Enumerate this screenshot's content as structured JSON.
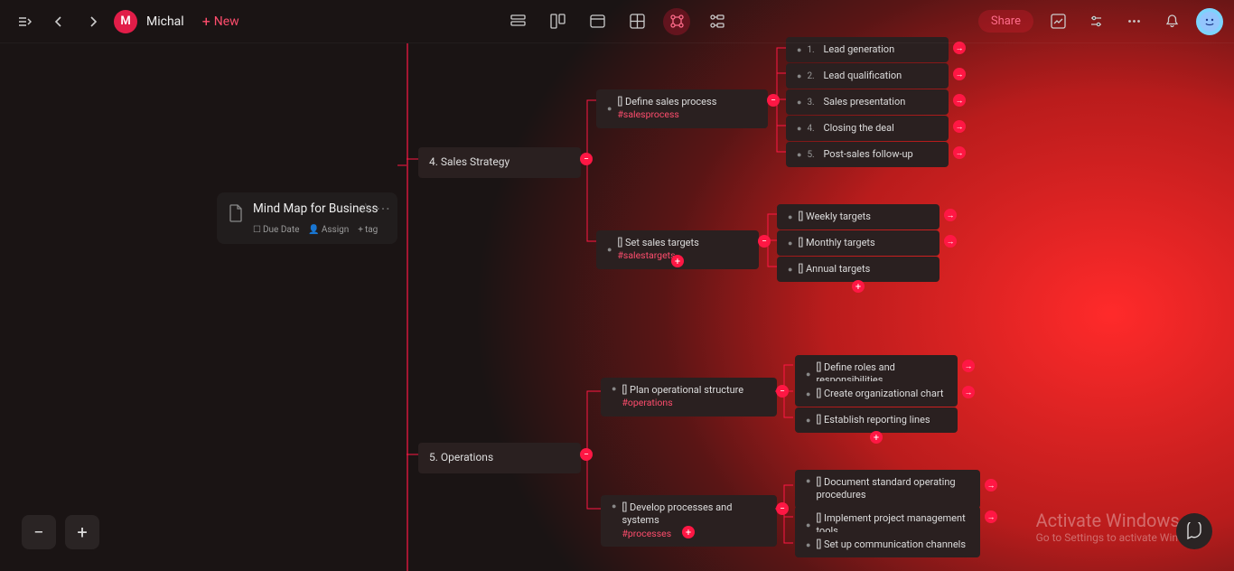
{
  "header": {
    "workspace_letter": "M",
    "workspace_name": "Michal",
    "new_label": "New",
    "share_label": "Share"
  },
  "root": {
    "title": "Mind Map for Business",
    "due_date_label": "Due Date",
    "assign_label": "Assign",
    "tag_label": "tag"
  },
  "branches": [
    {
      "id": "sales",
      "number": "4.",
      "label": "Sales Strategy",
      "children": [
        {
          "id": "define-sales",
          "checkbox": true,
          "label": "Define sales process",
          "hashtag": "#salesprocess",
          "children": [
            {
              "number": "1.",
              "label": "Lead generation"
            },
            {
              "number": "2.",
              "label": "Lead qualification"
            },
            {
              "number": "3.",
              "label": "Sales presentation"
            },
            {
              "number": "4.",
              "label": "Closing the deal"
            },
            {
              "number": "5.",
              "label": "Post-sales follow-up"
            }
          ]
        },
        {
          "id": "set-targets",
          "checkbox": true,
          "label": "Set sales targets",
          "hashtag": "#salestargets",
          "children": [
            {
              "checkbox": true,
              "label": "Weekly targets"
            },
            {
              "checkbox": true,
              "label": "Monthly targets"
            },
            {
              "checkbox": true,
              "label": "Annual targets"
            }
          ]
        }
      ]
    },
    {
      "id": "operations",
      "number": "5.",
      "label": "Operations",
      "children": [
        {
          "id": "plan-structure",
          "checkbox": true,
          "label": "Plan operational structure",
          "hashtag": "#operations",
          "children": [
            {
              "checkbox": true,
              "label": "Define roles and responsibilities"
            },
            {
              "checkbox": true,
              "label": "Create organizational chart"
            },
            {
              "checkbox": true,
              "label": "Establish reporting lines"
            }
          ]
        },
        {
          "id": "develop-processes",
          "checkbox": true,
          "label": "Develop processes and systems",
          "hashtag": "#processes",
          "children": [
            {
              "checkbox": true,
              "label": "Document standard operating procedures"
            },
            {
              "checkbox": true,
              "label": "Implement project management tools"
            },
            {
              "checkbox": true,
              "label": "Set up communication channels"
            }
          ]
        }
      ]
    }
  ],
  "watermark": {
    "line1": "Activate Windows",
    "line2": "Go to Settings to activate Windows."
  },
  "zoom": {
    "out": "−",
    "in": "+"
  }
}
